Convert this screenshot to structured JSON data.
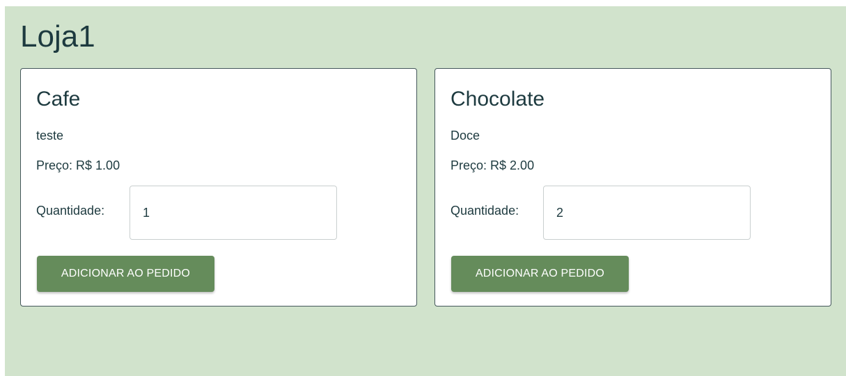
{
  "store": {
    "title": "Loja1"
  },
  "products": [
    {
      "name": "Cafe",
      "description": "teste",
      "price_label": "Preço:",
      "price": "R$ 1.00",
      "quantity_label": "Quantidade:",
      "quantity": "1",
      "button_label": "ADICIONAR AO PEDIDO"
    },
    {
      "name": "Chocolate",
      "description": "Doce",
      "price_label": "Preço:",
      "price": "R$ 2.00",
      "quantity_label": "Quantidade:",
      "quantity": "2",
      "button_label": "ADICIONAR AO PEDIDO"
    }
  ],
  "colors": {
    "background": "#d1e3cc",
    "text": "#1d3a3f",
    "button": "#658c5b"
  }
}
